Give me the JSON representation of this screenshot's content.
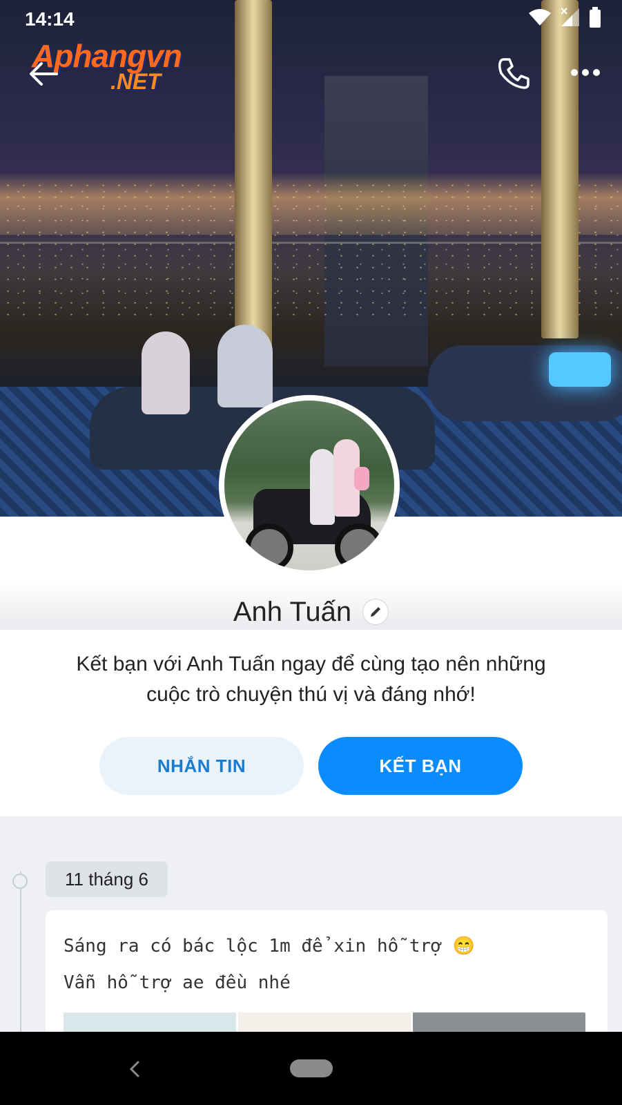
{
  "status_bar": {
    "time": "14:14",
    "icons": [
      "wifi-icon",
      "signal-icon",
      "battery-icon"
    ]
  },
  "top_bar": {
    "logo_text_main": "Aphangvn",
    "logo_text_sub": ".NET",
    "back_icon": "back-arrow-icon",
    "call_icon": "phone-icon",
    "more_icon": "more-icon"
  },
  "profile": {
    "name": "Anh Tuấn",
    "edit_icon": "pencil-icon"
  },
  "invite": {
    "text": "Kết bạn với Anh Tuấn ngay để cùng tạo nên những cuộc trò chuyện thú vị và đáng nhớ!",
    "message_label": "NHẮN TIN",
    "add_friend_label": "KẾT BẠN"
  },
  "timeline": {
    "date": "11 tháng 6",
    "post_line1": "Sáng ra có bác lộc 1m để xin hỗ trợ 😁",
    "post_line2": "Vẫn hỗ trợ ae đều nhé"
  },
  "colors": {
    "accent": "#0a8cff",
    "message_button_bg": "#eaf3fb",
    "message_button_text": "#1a7ccf",
    "timeline_bg": "#eef0f3"
  }
}
